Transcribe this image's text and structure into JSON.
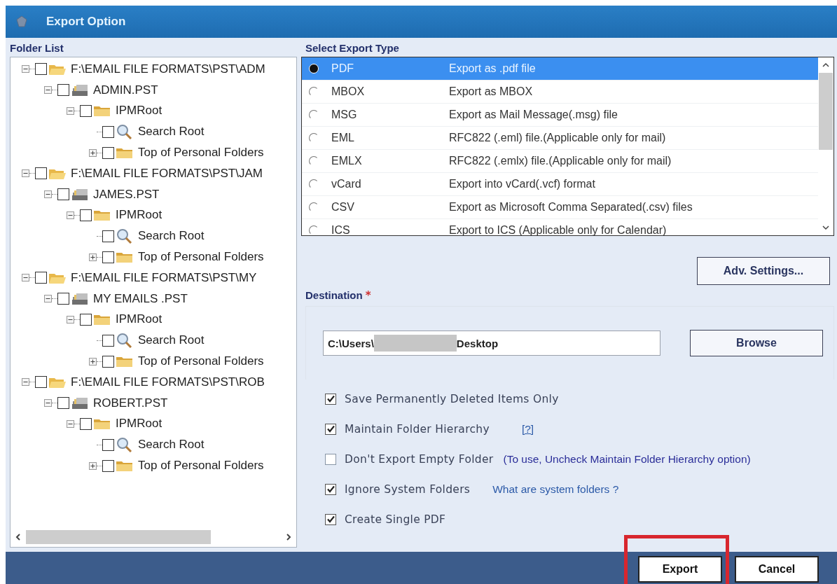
{
  "window": {
    "title": "Export Option"
  },
  "folder_list": {
    "heading": "Folder List",
    "tree": [
      {
        "label": "F:\\EMAIL FILE FORMATS\\PST\\ADM",
        "kind": "folder-open",
        "checked": false,
        "expanded": true,
        "children": [
          {
            "label": "ADMIN.PST",
            "kind": "pst",
            "checked": false,
            "expanded": true,
            "children": [
              {
                "label": "IPMRoot",
                "kind": "folder",
                "checked": false,
                "expanded": true,
                "children": [
                  {
                    "label": "Search Root",
                    "kind": "search",
                    "checked": false
                  },
                  {
                    "label": "Top of Personal Folders",
                    "kind": "folder",
                    "checked": false,
                    "expanded": false
                  }
                ]
              }
            ]
          }
        ]
      },
      {
        "label": "F:\\EMAIL FILE FORMATS\\PST\\JAM",
        "kind": "folder-open",
        "checked": false,
        "expanded": true,
        "children": [
          {
            "label": "JAMES.PST",
            "kind": "pst",
            "checked": false,
            "expanded": true,
            "children": [
              {
                "label": "IPMRoot",
                "kind": "folder",
                "checked": false,
                "expanded": true,
                "children": [
                  {
                    "label": "Search Root",
                    "kind": "search",
                    "checked": false
                  },
                  {
                    "label": "Top of Personal Folders",
                    "kind": "folder",
                    "checked": false,
                    "expanded": false
                  }
                ]
              }
            ]
          }
        ]
      },
      {
        "label": "F:\\EMAIL FILE FORMATS\\PST\\MY",
        "kind": "folder-open",
        "checked": false,
        "expanded": true,
        "children": [
          {
            "label": "MY EMAILS .PST",
            "kind": "pst",
            "checked": false,
            "expanded": true,
            "children": [
              {
                "label": "IPMRoot",
                "kind": "folder",
                "checked": false,
                "expanded": true,
                "children": [
                  {
                    "label": "Search Root",
                    "kind": "search",
                    "checked": false
                  },
                  {
                    "label": "Top of Personal Folders",
                    "kind": "folder",
                    "checked": false,
                    "expanded": false
                  }
                ]
              }
            ]
          }
        ]
      },
      {
        "label": "F:\\EMAIL FILE FORMATS\\PST\\ROB",
        "kind": "folder-open",
        "checked": false,
        "expanded": true,
        "children": [
          {
            "label": "ROBERT.PST",
            "kind": "pst",
            "checked": false,
            "expanded": true,
            "children": [
              {
                "label": "IPMRoot",
                "kind": "folder",
                "checked": false,
                "expanded": true,
                "children": [
                  {
                    "label": "Search Root",
                    "kind": "search",
                    "checked": false
                  },
                  {
                    "label": "Top of Personal Folders",
                    "kind": "folder",
                    "checked": false,
                    "expanded": false
                  }
                ]
              }
            ]
          }
        ]
      }
    ]
  },
  "export_type": {
    "heading": "Select Export Type",
    "types": [
      {
        "name": "PDF",
        "description": "Export as .pdf file",
        "selected": true
      },
      {
        "name": "MBOX",
        "description": "Export as MBOX",
        "selected": false
      },
      {
        "name": "MSG",
        "description": "Export as Mail Message(.msg) file",
        "selected": false
      },
      {
        "name": "EML",
        "description": "RFC822 (.eml) file.(Applicable only for mail)",
        "selected": false
      },
      {
        "name": "EMLX",
        "description": "RFC822 (.emlx) file.(Applicable only for mail)",
        "selected": false
      },
      {
        "name": "vCard",
        "description": "Export into vCard(.vcf) format",
        "selected": false
      },
      {
        "name": "CSV",
        "description": "Export as Microsoft Comma Separated(.csv) files",
        "selected": false
      },
      {
        "name": "ICS",
        "description": "Export to ICS (Applicable only for Calendar)",
        "selected": false
      }
    ]
  },
  "adv_settings_button": "Adv. Settings...",
  "destination": {
    "label": "Destination",
    "required_mark": "*",
    "value_start": "C:\\Users\\",
    "value_end": "Desktop",
    "redacted": true,
    "browse_button": "Browse"
  },
  "options": [
    {
      "label": "Save Permanently Deleted Items Only",
      "checked": true
    },
    {
      "label": "Maintain Folder Hierarchy",
      "checked": true,
      "aside": {
        "text": "[?]",
        "kind": "link"
      }
    },
    {
      "label": "Don't Export Empty Folder",
      "checked": false,
      "aside": {
        "text": "(To use, Uncheck Maintain Folder Hierarchy option)",
        "kind": "hint"
      }
    },
    {
      "label": "Ignore System Folders",
      "checked": true,
      "aside": {
        "text": "What are system folders ?",
        "kind": "link"
      }
    },
    {
      "label": "Create Single PDF",
      "checked": true
    }
  ],
  "buttons": [
    {
      "label": "Export",
      "highlighted": true
    },
    {
      "label": "Cancel",
      "highlighted": false
    }
  ]
}
